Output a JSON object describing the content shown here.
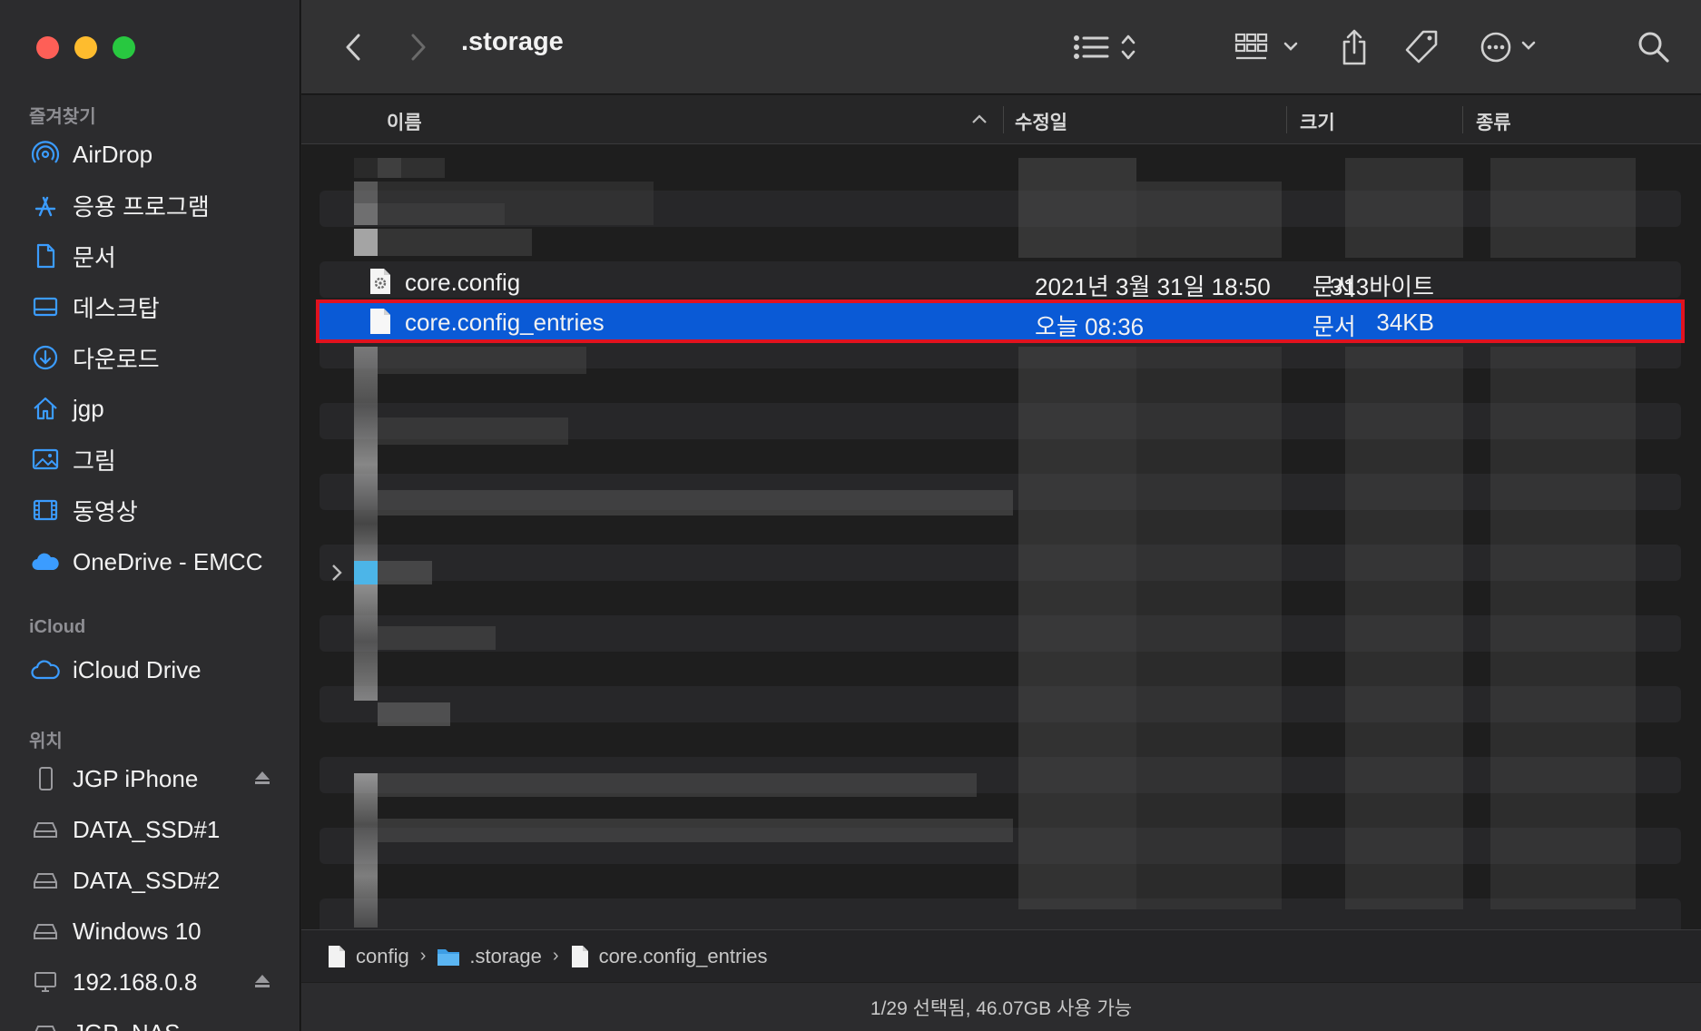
{
  "window": {
    "title": ".storage",
    "traffic_lights": [
      "close",
      "minimize",
      "zoom"
    ]
  },
  "sidebar": {
    "sections": [
      {
        "heading": "즐겨찾기",
        "items": [
          {
            "label": "AirDrop",
            "icon": "airdrop-icon"
          },
          {
            "label": "응용 프로그램",
            "icon": "applications-icon"
          },
          {
            "label": "문서",
            "icon": "document-icon"
          },
          {
            "label": "데스크탑",
            "icon": "desktop-icon"
          },
          {
            "label": "다운로드",
            "icon": "download-icon"
          },
          {
            "label": "jgp",
            "icon": "home-icon"
          },
          {
            "label": "그림",
            "icon": "pictures-icon"
          },
          {
            "label": "동영상",
            "icon": "movies-icon"
          },
          {
            "label": "OneDrive - EMCC",
            "icon": "cloud-filled-icon"
          }
        ]
      },
      {
        "heading": "iCloud",
        "items": [
          {
            "label": "iCloud Drive",
            "icon": "cloud-icon"
          }
        ]
      },
      {
        "heading": "위치",
        "items": [
          {
            "label": "JGP iPhone",
            "icon": "iphone-icon",
            "eject": true
          },
          {
            "label": "DATA_SSD#1",
            "icon": "drive-icon"
          },
          {
            "label": "DATA_SSD#2",
            "icon": "drive-icon"
          },
          {
            "label": "Windows 10",
            "icon": "drive-icon"
          },
          {
            "label": "192.168.0.8",
            "icon": "monitor-icon",
            "eject": true
          },
          {
            "label": "JGP_NAS",
            "icon": "drive-icon"
          }
        ]
      }
    ]
  },
  "toolbar": {
    "back_icon": "chevron-left-icon",
    "forward_icon": "chevron-right-icon",
    "view_icon": "list-view-icon",
    "group_icon": "grid-group-icon",
    "share_icon": "share-icon",
    "tag_icon": "tag-icon",
    "more_icon": "ellipsis-circle-icon",
    "search_icon": "search-icon"
  },
  "columns": {
    "name": "이름",
    "modified": "수정일",
    "size": "크기",
    "kind": "종류",
    "sort_indicator": "chevron-up-icon"
  },
  "files": [
    {
      "name": "core.config",
      "modified": "2021년 3월 31일 18:50",
      "size": "313바이트",
      "kind": "문서",
      "icon": "config-file-icon",
      "selected": false
    },
    {
      "name": "core.config_entries",
      "modified": "오늘 08:36",
      "size": "34KB",
      "kind": "문서",
      "icon": "file-icon",
      "selected": true
    }
  ],
  "pathbar": {
    "segments": [
      {
        "label": "config",
        "icon": "file-icon"
      },
      {
        "label": ".storage",
        "icon": "folder-icon"
      },
      {
        "label": "core.config_entries",
        "icon": "file-icon"
      }
    ]
  },
  "status": {
    "text": "1/29 선택됨, 46.07GB 사용 가능"
  },
  "colors": {
    "selection": "#0a5ad6",
    "highlight_outline": "#e0121f",
    "sidebar_accent": "#3b9cff"
  }
}
